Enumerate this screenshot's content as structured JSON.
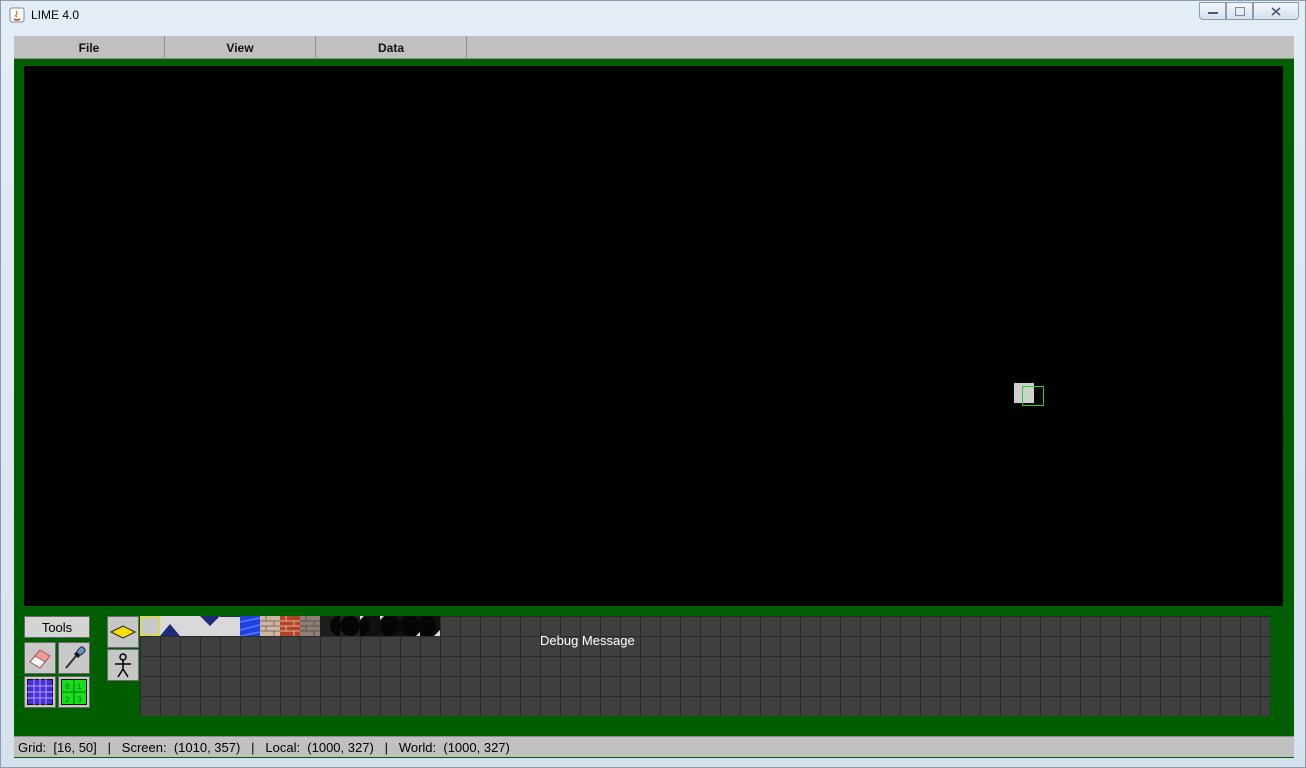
{
  "window": {
    "title": "LIME 4.0",
    "controls": [
      "minimize",
      "maximize",
      "close"
    ]
  },
  "menubar": {
    "items": [
      "File",
      "View",
      "Data"
    ]
  },
  "toolbox": {
    "label": "Tools",
    "tools": [
      "eraser-icon",
      "eyedropper-icon",
      "grid-icon",
      "numbered-grid-icon"
    ],
    "grid_digits": [
      "0",
      "1",
      "2",
      "3"
    ]
  },
  "tile_types": [
    "tile-layer-icon",
    "sprite-layer-icon"
  ],
  "palette": {
    "debug_message": "Debug Message",
    "tiles": [
      "selected-empty",
      "white-blue-triangle",
      "white-blue-triangle-down",
      "blue-water",
      "brick-light",
      "brick-red",
      "brick-gray",
      "dark-circle-1",
      "dark-circle-2",
      "dark-circle-3",
      "dark-circle-4"
    ]
  },
  "status": {
    "text": "Grid:  [16, 50]   |   Screen:  (1010, 357)   |   Local:  (1000, 327)   |   World:  (1000, 327)"
  },
  "colors": {
    "frame_green": "#005e00",
    "canvas": "#000000",
    "menubar": "#c0c0c0",
    "palette_bg": "#3f3f3f"
  }
}
